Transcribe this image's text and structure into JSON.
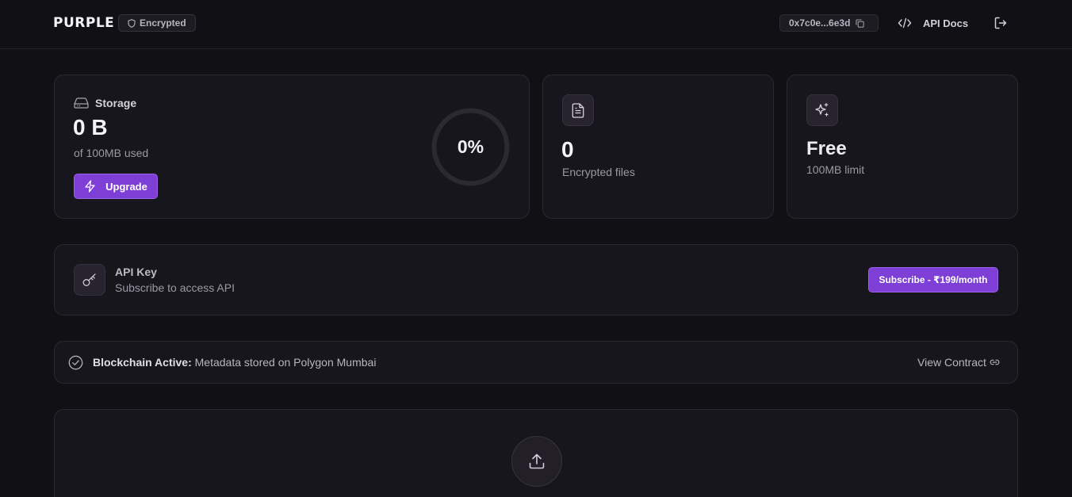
{
  "header": {
    "logo": "PURPLE",
    "badge": "Encrypted",
    "wallet": "0x7c0e...6e3d",
    "api_docs": "API Docs"
  },
  "storage": {
    "label": "Storage",
    "used": "0 B",
    "of_text": "of 100MB used",
    "upgrade": "Upgrade",
    "percent": "0%",
    "percent_value": 0
  },
  "files": {
    "count": "0",
    "label": "Encrypted files"
  },
  "plan": {
    "name": "Free",
    "limit": "100MB limit"
  },
  "api": {
    "title": "API Key",
    "subtitle": "Subscribe to access API",
    "subscribe": "Subscribe - ₹199/month"
  },
  "blockchain": {
    "status_bold": "Blockchain Active:",
    "status_text": " Metadata stored on Polygon Mumbai",
    "view_contract": "View Contract"
  },
  "colors": {
    "accent": "#7e3fd6",
    "background": "#111015",
    "card": "#17161c"
  }
}
